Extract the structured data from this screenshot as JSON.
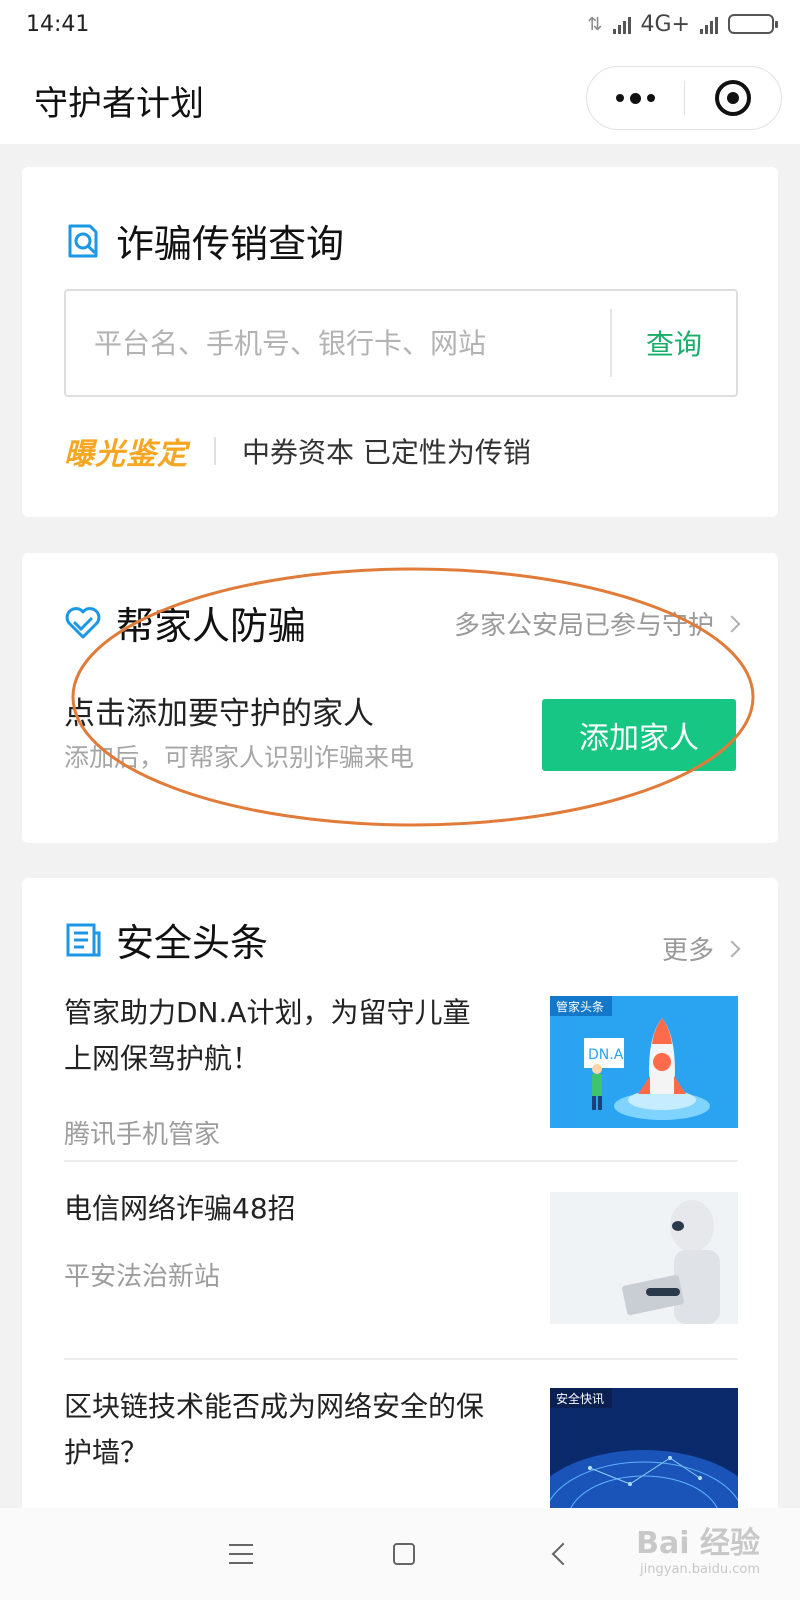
{
  "status_bar": {
    "time": "14:41",
    "network": "4G+",
    "battery_color": "#f5a623"
  },
  "nav": {
    "title": "守护者计划",
    "more_icon": "more-dots-icon",
    "close_icon": "target-icon"
  },
  "query_card": {
    "title": "诈骗传销查询",
    "icon": "search-document-icon",
    "search_placeholder": "平台名、手机号、银行卡、网站",
    "search_button": "查询",
    "expose_tag": "曝光鉴定",
    "expose_text": "中券资本 已定性为传销"
  },
  "family_card": {
    "title": "帮家人防骗",
    "icon": "heart-icon",
    "link_text": "多家公安局已参与守护",
    "main_text": "点击添加要守护的家人",
    "sub_text": "添加后，可帮家人识别诈骗来电",
    "add_button": "添加家人",
    "accent": "#17c683"
  },
  "news_card": {
    "title": "安全头条",
    "icon": "newspaper-icon",
    "more_label": "更多",
    "items": [
      {
        "title": "管家助力DN.A计划，为留守儿童上网保驾护航！",
        "source": "腾讯手机管家",
        "thumb_label": "管家头条",
        "thumb_text": "DN.A"
      },
      {
        "title": "电信网络诈骗48招",
        "source": "平安法治新站",
        "thumb_label": "",
        "thumb_text": ""
      },
      {
        "title": "区块链技术能否成为网络安全的保护墙？",
        "source": "",
        "thumb_label": "安全快讯",
        "thumb_text": ""
      }
    ]
  },
  "bottom_nav": {
    "menu_icon": "menu-icon",
    "home_icon": "home-square-icon",
    "back_icon": "back-chevron-icon"
  },
  "watermark": {
    "brand": "Bai 经验",
    "url": "jingyan.baidu.com"
  },
  "colors": {
    "primary_green": "#1aad6a",
    "button_green": "#17c683",
    "icon_blue": "#1a98e6",
    "expose_orange": "#f5a623",
    "annotation_orange": "#e07b39"
  }
}
